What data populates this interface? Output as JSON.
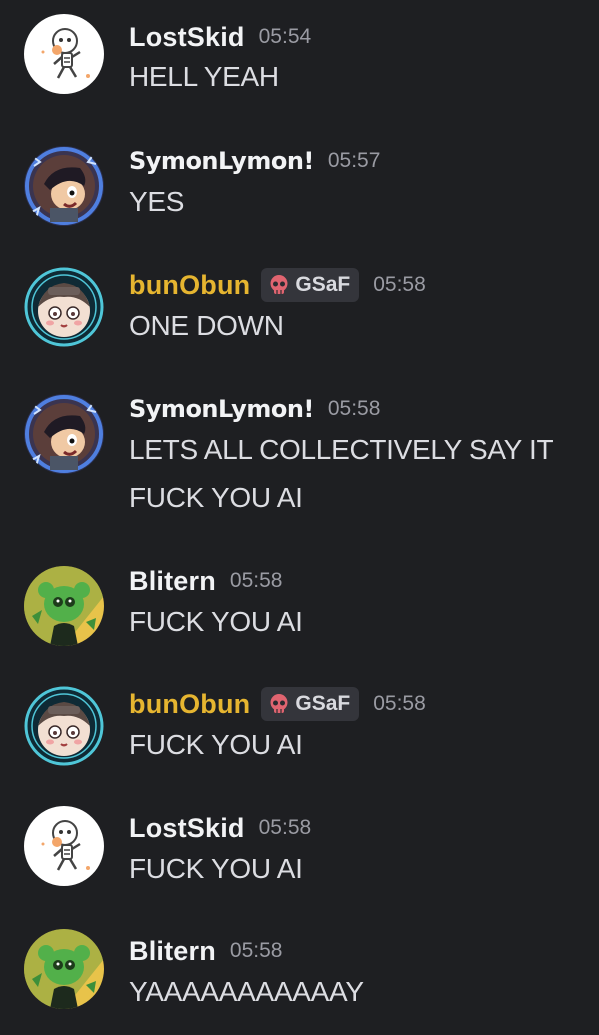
{
  "messages": [
    {
      "author": "LostSkid",
      "timestamp": "05:54",
      "lines": [
        "HELL YEAH"
      ]
    },
    {
      "author": "SymonLymon!",
      "timestamp": "05:57",
      "lines": [
        "YES"
      ]
    },
    {
      "author": "bunObun",
      "tag": "GSaF",
      "timestamp": "05:58",
      "lines": [
        "ONE DOWN"
      ]
    },
    {
      "author": "SymonLymon!",
      "timestamp": "05:58",
      "lines": [
        "LETS ALL COLLECTIVELY SAY IT",
        "FUCK YOU AI"
      ]
    },
    {
      "author": "Blitern",
      "timestamp": "05:58",
      "lines": [
        "FUCK YOU AI"
      ]
    },
    {
      "author": "bunObun",
      "tag": "GSaF",
      "timestamp": "05:58",
      "lines": [
        "FUCK YOU AI"
      ]
    },
    {
      "author": "LostSkid",
      "timestamp": "05:58",
      "lines": [
        "FUCK YOU AI"
      ]
    },
    {
      "author": "Blitern",
      "timestamp": "05:58",
      "lines": [
        "YAAAAAAAAAAAY"
      ]
    }
  ],
  "icons": {
    "tag": "skull-icon",
    "avatars": [
      "skeleton-avatar",
      "dark-hair-character-avatar",
      "glasses-character-avatar",
      "green-creature-avatar"
    ]
  },
  "colors": {
    "background": "#1e1f22",
    "username": "#f2f3f5",
    "username_role": "#e6b530",
    "message_text": "#dcdde2",
    "timestamp": "#9a9ba3",
    "tag_background": "#34353b",
    "skull": "#e06470"
  }
}
